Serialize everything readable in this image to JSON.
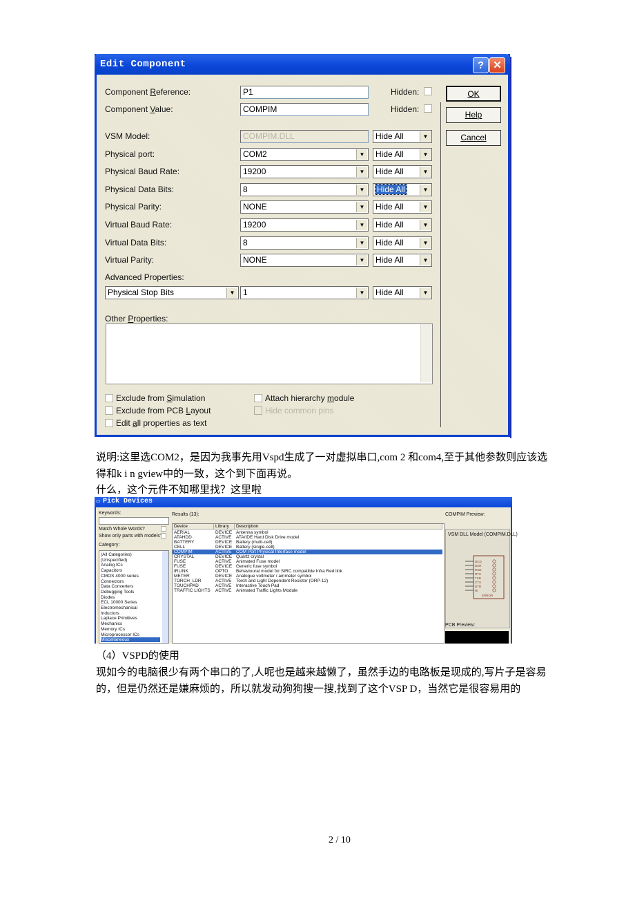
{
  "dialog": {
    "title": "Edit Component",
    "help_glyph": "?",
    "close_glyph": "✕",
    "fields": [
      {
        "label": "Component Reference:",
        "ul": "R",
        "value": "P1",
        "hidden_label": "Hidden:"
      },
      {
        "label": "Component Value:",
        "ul": "V",
        "value": "COMPIM",
        "hidden_label": "Hidden:"
      }
    ],
    "props": [
      {
        "label": "VSM Model:",
        "value": "COMPIM.DLL",
        "vis": "Hide All",
        "disabled": true
      },
      {
        "label": "Physical port:",
        "value": "COM2",
        "vis": "Hide All"
      },
      {
        "label": "Physical Baud Rate:",
        "value": "19200",
        "vis": "Hide All"
      },
      {
        "label": "Physical Data Bits:",
        "value": "8",
        "vis": "Hide All",
        "vis_selected": true
      },
      {
        "label": "Physical Parity:",
        "value": "NONE",
        "vis": "Hide All"
      },
      {
        "label": "Virtual Baud Rate:",
        "value": "19200",
        "vis": "Hide All"
      },
      {
        "label": "Virtual Data Bits:",
        "value": "8",
        "vis": "Hide All"
      },
      {
        "label": "Virtual Parity:",
        "value": "NONE",
        "vis": "Hide All"
      }
    ],
    "advanced": {
      "label": "Advanced Properties:",
      "property": "Physical Stop Bits",
      "value": "1",
      "vis": "Hide All"
    },
    "other_label": "Other Properties:",
    "other_value": "",
    "checkboxes": [
      {
        "label": "Exclude from Simulation",
        "checked": false
      },
      {
        "label": "Exclude from PCB Layout",
        "checked": false
      },
      {
        "label": "Edit all properties as text",
        "checked": false
      },
      {
        "label": "Attach hierarchy module",
        "checked": false
      },
      {
        "label": "Hide common pins",
        "checked": false,
        "disabled": true
      }
    ],
    "buttons": {
      "ok": "OK",
      "help": "Help",
      "cancel": "Cancel"
    }
  },
  "text": {
    "p1_line1": "说明:这里选COM2，是因为我事先用Vspd生成了一对虚拟串口,com 2 和com4,至于其他参数则应该选",
    "p1_line2": "得和k i n gview中的一致，这个到下面再说。",
    "p2": "什么，这个元件不知哪里找？这里啦",
    "heading": "（4）VSPD的使用",
    "p3_line1": "现如今的电脑很少有两个串口的了,人呢也是越来越懒了，虽然手边的电路板是现成的,写片子是容易",
    "p3_line2": "的，但是仍然还是嫌麻烦的，所以就发动狗狗搜一搜,找到了这个VSP D，当然它是很容易用的",
    "page_number": "2 / 10"
  },
  "pick": {
    "title": "Pick Devices",
    "keywords_label": "Keywords:",
    "keywords_value": "",
    "match_whole": "Match Whole Words?",
    "show_only": "Show only parts with models?",
    "category_label": "Category:",
    "categories": [
      "(All Categories)",
      "(Unspecified)",
      "Analog ICs",
      "Capacitors",
      "CMOS 4000 series",
      "Connectors",
      "Data Converters",
      "Debugging Tools",
      "Diodes",
      "ECL 10000 Series",
      "Electromechanical",
      "Inductors",
      "Laplace Primitives",
      "Mechanics",
      "Memory ICs",
      "Microprocessor ICs",
      "Miscellaneous"
    ],
    "selected_category": "Miscellaneous",
    "results_label": "Results (13):",
    "columns": [
      "Device",
      "Library",
      "Description"
    ],
    "rows": [
      [
        "AERIAL",
        "DEVICE",
        "Antenna symbol"
      ],
      [
        "ATAHDD",
        "ACTIVE",
        "ATA/IDE Hard Disk Drive model"
      ],
      [
        "BATTERY",
        "DEVICE",
        "Battery (multi-cell)"
      ],
      [
        "CELL",
        "DEVICE",
        "Battery (single-cell)"
      ],
      [
        "COMPIM",
        "ACTIVE",
        "COM Port Physical Interface model"
      ],
      [
        "CRYSTAL",
        "DEVICE",
        "Quartz crystal"
      ],
      [
        "FUSE",
        "ACTIVE",
        "Animated Fuse model"
      ],
      [
        "FUSE",
        "DEVICE",
        "Generic fuse symbol"
      ],
      [
        "IRLINK",
        "OPTO",
        "Behavioural model for SIRC compatible Infra Red link"
      ],
      [
        "METER",
        "DEVICE",
        "Analogue voltmeter / ammeter symbol"
      ],
      [
        "TORCH_LDR",
        "ACTIVE",
        "Torch and Light Dependent Resistor (ORP-12)"
      ],
      [
        "TOUCHPAD",
        "ACTIVE",
        "Interactive Touch Pad"
      ],
      [
        "TRAFFIC LIGHTS",
        "ACTIVE",
        "Animated Traffic Lights Module"
      ]
    ],
    "selected_row": 4,
    "preview_label": "COMPIM Preview:",
    "preview_model": "VSM DLL Model (COMPIM.DLL)",
    "pins": [
      "DCD",
      "DSR",
      "RXD",
      "RTS",
      "TXD",
      "CTS",
      "DTR",
      "RI"
    ],
    "error_label": "ERROR",
    "pcb_preview_label": "PCB Preview:"
  }
}
